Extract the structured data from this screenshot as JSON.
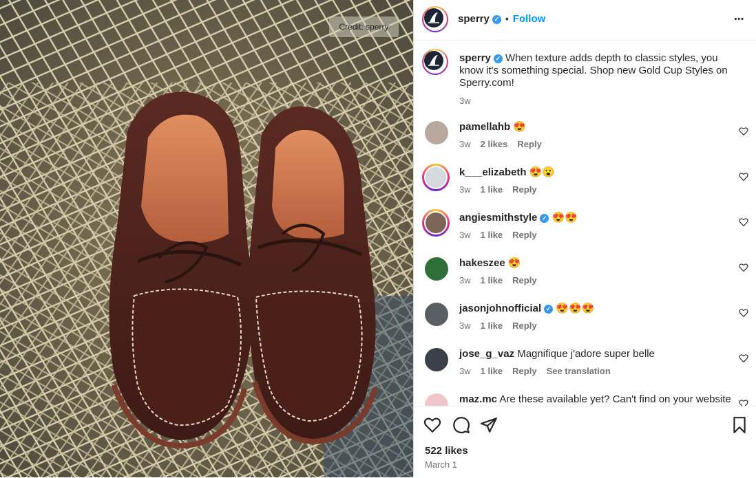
{
  "photo": {
    "credit": "Credit: sperry",
    "alt": "Pair of brown woven suede boat shoes on fishing net"
  },
  "header": {
    "username": "sperry",
    "verified_mark": "✓",
    "separator": "•",
    "follow_label": "Follow",
    "more_label": "•••"
  },
  "caption": {
    "username": "sperry",
    "text": "When texture adds depth to classic styles, you know it's something special. Shop new Gold Cup Styles on Sperry.com!",
    "time": "3w"
  },
  "comments": [
    {
      "username": "pamellahb",
      "text": "😍",
      "time": "3w",
      "likes": "2 likes",
      "reply": "Reply",
      "verified": false
    },
    {
      "username": "k___elizabeth",
      "text": "😍😮",
      "time": "3w",
      "likes": "1 like",
      "reply": "Reply",
      "verified": false
    },
    {
      "username": "angiesmithstyle",
      "text": "😍😍",
      "time": "3w",
      "likes": "1 like",
      "reply": "Reply",
      "verified": true
    },
    {
      "username": "hakeszee",
      "text": "😍",
      "time": "3w",
      "likes": "1 like",
      "reply": "Reply",
      "verified": false
    },
    {
      "username": "jasonjohnofficial",
      "text": "😍😍😍",
      "time": "3w",
      "likes": "1 like",
      "reply": "Reply",
      "verified": true
    },
    {
      "username": "jose_g_vaz",
      "text": "Magnifique j'adore super belle",
      "time": "3w",
      "likes": "1 like",
      "reply": "Reply",
      "extra": "See translation",
      "verified": false
    },
    {
      "username": "maz.mc",
      "text": "Are these available yet? Can't find on your website",
      "verified": false
    }
  ],
  "footer": {
    "likes": "522 likes",
    "date": "March 1"
  },
  "colors": {
    "accent": "#0095f6",
    "verified": "#3897f0",
    "muted": "#737373"
  },
  "icons": [
    "heart-icon",
    "comment-icon",
    "share-icon",
    "bookmark-icon",
    "more-icon",
    "verified-icon"
  ]
}
